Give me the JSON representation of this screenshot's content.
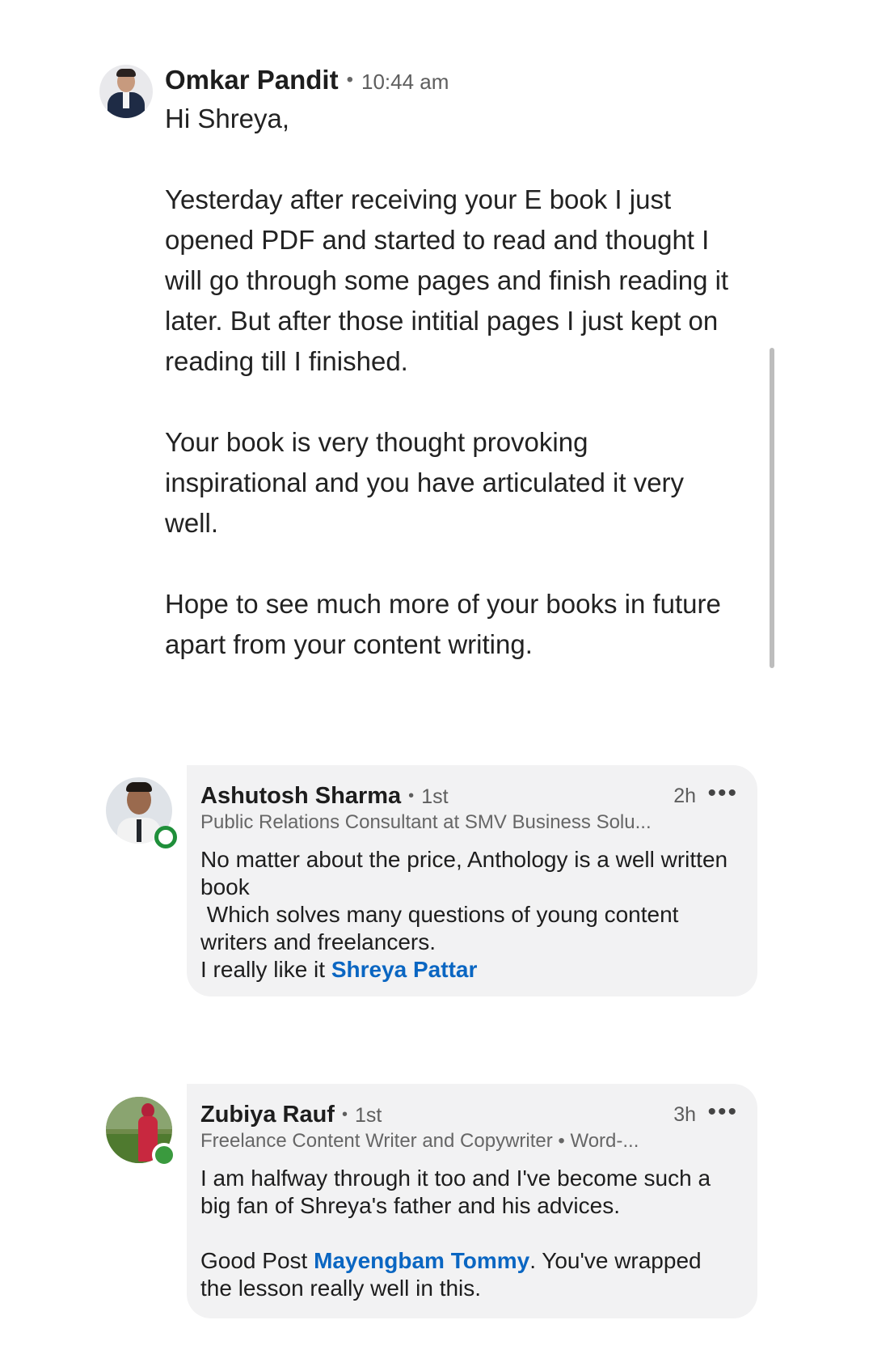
{
  "message": {
    "sender": "Omkar Pandit",
    "separator": "•",
    "time": "10:44 am",
    "paragraphs": [
      "Hi Shreya,",
      "Yesterday after receiving your E book I just opened PDF and started to read and thought I will go through some pages and finish reading it later. But after those intitial pages I just kept on reading till I finished.",
      "Your book is very thought provoking inspirational and you have articulated it very well.",
      "Hope to see much more of your books in future apart from your content writing."
    ]
  },
  "comments": [
    {
      "name": "Ashutosh Sharma",
      "separator": "•",
      "degree": "1st",
      "time": "2h",
      "more": "•••",
      "headline": "Public Relations Consultant at SMV Business Solu...",
      "lines": [
        "No matter about the price, Anthology is a well written book",
        " Which solves many questions of young content writers and freelancers."
      ],
      "last_line_prefix": "I really like it ",
      "mention": "Shreya Pattar"
    },
    {
      "name": "Zubiya Rauf",
      "separator": "•",
      "degree": "1st",
      "time": "3h",
      "more": "•••",
      "headline": "Freelance Content Writer and Copywriter • Word-...",
      "line1": "I am halfway through it too and I've become such a big fan of Shreya's father and his advices.",
      "post_prefix": "Good Post ",
      "mention": "Mayengbam Tommy",
      "post_suffix": ". You've wrapped the lesson really well in this."
    }
  ],
  "colors": {
    "mention": "#0a66c2",
    "bubble": "#f2f2f3",
    "online": "#1f8f3a"
  }
}
